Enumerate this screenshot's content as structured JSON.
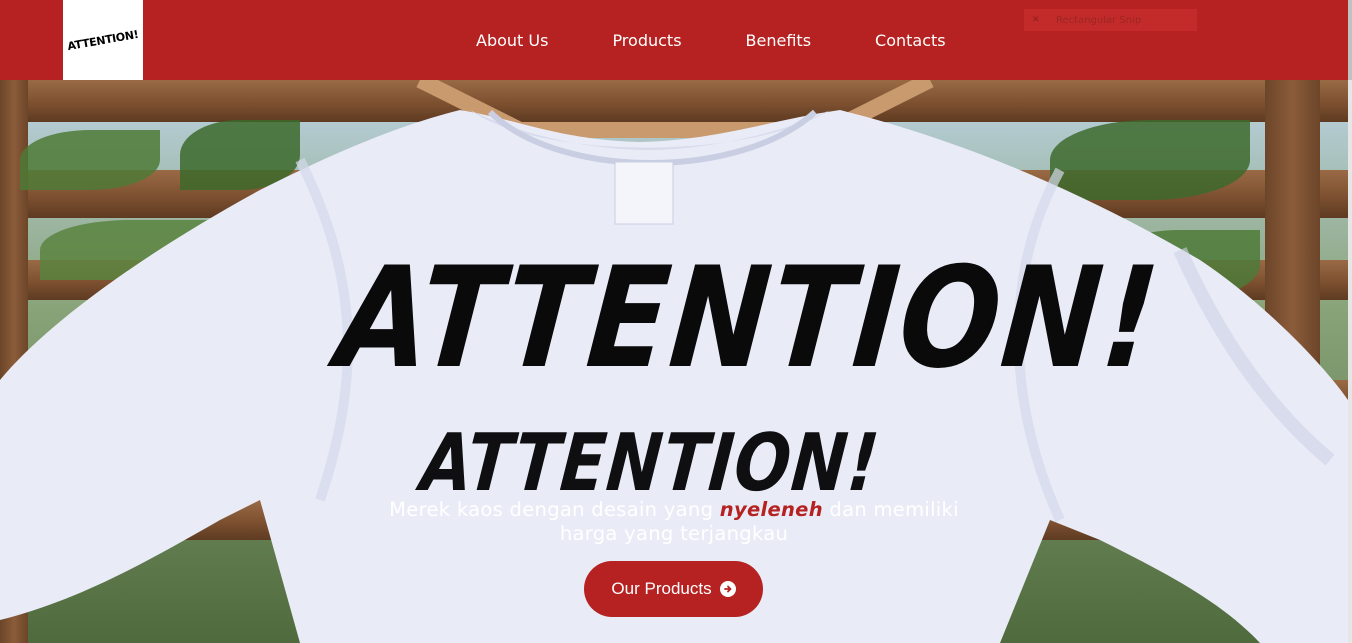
{
  "brand": {
    "logo_text": "ATTENTION!"
  },
  "nav": {
    "items": [
      {
        "label": "About Us"
      },
      {
        "label": "Products"
      },
      {
        "label": "Benefits"
      },
      {
        "label": "Contacts"
      }
    ]
  },
  "snip_tool": {
    "label": "Rectangular Snip",
    "icon": "close-icon"
  },
  "hero": {
    "shirt_print_large": "ATTENTION!",
    "shirt_print_small": "ATTENTION!",
    "tagline_before": "Merek kaos dengan desain yang ",
    "tagline_highlight": "nyeleneh",
    "tagline_after": " dan memiliki harga yang terjangkau",
    "cta_label": "Our Products",
    "cta_icon": "arrow-circle-right-icon"
  },
  "colors": {
    "brand_red": "#b52221",
    "white": "#ffffff"
  }
}
